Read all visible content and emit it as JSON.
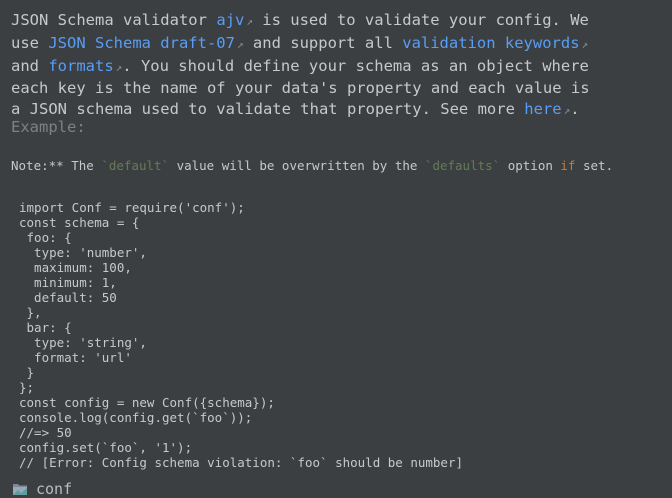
{
  "doc": {
    "line1": {
      "t1": "JSON Schema validator ",
      "link_ajv": "ajv",
      "t2": " is used to validate your config. We"
    },
    "line2": {
      "t1": "use ",
      "link_schema": "JSON Schema draft-07",
      "t2": " and support all ",
      "link_keywords": "validation keywords"
    },
    "line3": {
      "t1": "and ",
      "link_formats": "formats",
      "t2": ". You should define your schema as an object where"
    },
    "line4": "each key is the name of your data's property and each value is",
    "line5": {
      "t1": "a JSON schema used to validate that property. See more ",
      "link_here": "here",
      "t2": "."
    },
    "arrow_glyph": "↗"
  },
  "example_label": "Example:",
  "note": {
    "t1": "Note:** The ",
    "code1": "`default`",
    "t2": " value will be overwritten by the ",
    "code2": "`defaults`",
    "t3": " option ",
    "kw_if": "if",
    "t4": " set."
  },
  "code_lines": [
    "import Conf = require('conf');",
    "const schema = {",
    " foo: {",
    "  type: 'number',",
    "  maximum: 100,",
    "  minimum: 1,",
    "  default: 50",
    " },",
    " bar: {",
    "  type: 'string',",
    "  format: 'url'",
    " }",
    "};",
    "const config = new Conf({schema});",
    "console.log(config.get(`foo`));",
    "//=> 50",
    "config.set(`foo`, '1');",
    "// [Error: Config schema violation: `foo` should be number]"
  ],
  "footer": {
    "package_name": "conf",
    "icon": "package-icon"
  },
  "colors": {
    "background": "#3c3f41",
    "link": "#589df6",
    "text": "#c8c8c8",
    "muted": "#808080",
    "code_string": "#6a8759",
    "keyword": "#cc7832"
  }
}
